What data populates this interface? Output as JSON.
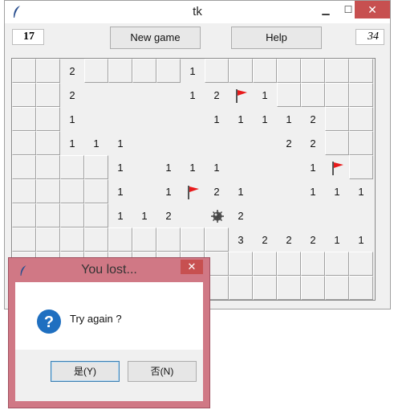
{
  "window": {
    "title": "tk",
    "controls": {
      "minimize": "▁",
      "maximize": "☐",
      "close": "✕"
    }
  },
  "toolbar": {
    "mines_left": "17",
    "new_game_label": "New game",
    "help_label": "Help",
    "timer": "34"
  },
  "board": {
    "cols": 15,
    "rows": 10,
    "open_rows": [
      "Fraaaaaaaaaaaa",
      "",
      "",
      "",
      "",
      "",
      "",
      "",
      "",
      ""
    ],
    "cells": [
      "RR2RRRR1RRRRRRR",
      "RR2....12F1RRRR",
      "RR1.....11112RR",
      "RR111......22RR",
      "RRRR1.111...1FR",
      "RRRR1.1F21..111",
      "RRRR112.M2.....",
      "RRRRRRRRR322211",
      "RRRRRRRRRRRRRRR",
      "RRRRRRRRRRRRRRR"
    ],
    "legend": {
      "R": "unopened",
      ".": "empty",
      "F": "flag",
      "M": "mine"
    }
  },
  "dialog": {
    "title": "You lost...",
    "close": "✕",
    "message": "Try again ?",
    "yes_label": "是(Y)",
    "no_label": "否(N)"
  },
  "colors": {
    "flag": "#e8191a",
    "question_icon": "#1f6fc0",
    "dialog_frame": "#d07885"
  }
}
